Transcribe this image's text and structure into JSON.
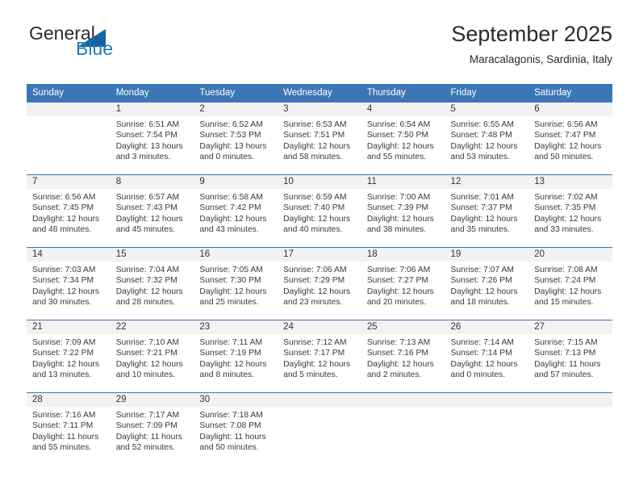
{
  "brand": {
    "name_part1": "General",
    "name_part2": "Blue",
    "logo_icon": "triangle-icon",
    "accent_color": "#1b7ac4"
  },
  "header": {
    "title": "September 2025",
    "subtitle": "Maracalagonis, Sardinia, Italy"
  },
  "theme": {
    "header_blue": "#3b77b7",
    "band_gray": "#f2f2f2",
    "text_color": "#3a3a3a"
  },
  "weekdays": [
    "Sunday",
    "Monday",
    "Tuesday",
    "Wednesday",
    "Thursday",
    "Friday",
    "Saturday"
  ],
  "weeks": [
    [
      {
        "day": "",
        "sunrise": "",
        "sunset": "",
        "daylight_line1": "",
        "daylight_line2": ""
      },
      {
        "day": "1",
        "sunrise": "Sunrise: 6:51 AM",
        "sunset": "Sunset: 7:54 PM",
        "daylight_line1": "Daylight: 13 hours",
        "daylight_line2": "and 3 minutes."
      },
      {
        "day": "2",
        "sunrise": "Sunrise: 6:52 AM",
        "sunset": "Sunset: 7:53 PM",
        "daylight_line1": "Daylight: 13 hours",
        "daylight_line2": "and 0 minutes."
      },
      {
        "day": "3",
        "sunrise": "Sunrise: 6:53 AM",
        "sunset": "Sunset: 7:51 PM",
        "daylight_line1": "Daylight: 12 hours",
        "daylight_line2": "and 58 minutes."
      },
      {
        "day": "4",
        "sunrise": "Sunrise: 6:54 AM",
        "sunset": "Sunset: 7:50 PM",
        "daylight_line1": "Daylight: 12 hours",
        "daylight_line2": "and 55 minutes."
      },
      {
        "day": "5",
        "sunrise": "Sunrise: 6:55 AM",
        "sunset": "Sunset: 7:48 PM",
        "daylight_line1": "Daylight: 12 hours",
        "daylight_line2": "and 53 minutes."
      },
      {
        "day": "6",
        "sunrise": "Sunrise: 6:56 AM",
        "sunset": "Sunset: 7:47 PM",
        "daylight_line1": "Daylight: 12 hours",
        "daylight_line2": "and 50 minutes."
      }
    ],
    [
      {
        "day": "7",
        "sunrise": "Sunrise: 6:56 AM",
        "sunset": "Sunset: 7:45 PM",
        "daylight_line1": "Daylight: 12 hours",
        "daylight_line2": "and 48 minutes."
      },
      {
        "day": "8",
        "sunrise": "Sunrise: 6:57 AM",
        "sunset": "Sunset: 7:43 PM",
        "daylight_line1": "Daylight: 12 hours",
        "daylight_line2": "and 45 minutes."
      },
      {
        "day": "9",
        "sunrise": "Sunrise: 6:58 AM",
        "sunset": "Sunset: 7:42 PM",
        "daylight_line1": "Daylight: 12 hours",
        "daylight_line2": "and 43 minutes."
      },
      {
        "day": "10",
        "sunrise": "Sunrise: 6:59 AM",
        "sunset": "Sunset: 7:40 PM",
        "daylight_line1": "Daylight: 12 hours",
        "daylight_line2": "and 40 minutes."
      },
      {
        "day": "11",
        "sunrise": "Sunrise: 7:00 AM",
        "sunset": "Sunset: 7:39 PM",
        "daylight_line1": "Daylight: 12 hours",
        "daylight_line2": "and 38 minutes."
      },
      {
        "day": "12",
        "sunrise": "Sunrise: 7:01 AM",
        "sunset": "Sunset: 7:37 PM",
        "daylight_line1": "Daylight: 12 hours",
        "daylight_line2": "and 35 minutes."
      },
      {
        "day": "13",
        "sunrise": "Sunrise: 7:02 AM",
        "sunset": "Sunset: 7:35 PM",
        "daylight_line1": "Daylight: 12 hours",
        "daylight_line2": "and 33 minutes."
      }
    ],
    [
      {
        "day": "14",
        "sunrise": "Sunrise: 7:03 AM",
        "sunset": "Sunset: 7:34 PM",
        "daylight_line1": "Daylight: 12 hours",
        "daylight_line2": "and 30 minutes."
      },
      {
        "day": "15",
        "sunrise": "Sunrise: 7:04 AM",
        "sunset": "Sunset: 7:32 PM",
        "daylight_line1": "Daylight: 12 hours",
        "daylight_line2": "and 28 minutes."
      },
      {
        "day": "16",
        "sunrise": "Sunrise: 7:05 AM",
        "sunset": "Sunset: 7:30 PM",
        "daylight_line1": "Daylight: 12 hours",
        "daylight_line2": "and 25 minutes."
      },
      {
        "day": "17",
        "sunrise": "Sunrise: 7:06 AM",
        "sunset": "Sunset: 7:29 PM",
        "daylight_line1": "Daylight: 12 hours",
        "daylight_line2": "and 23 minutes."
      },
      {
        "day": "18",
        "sunrise": "Sunrise: 7:06 AM",
        "sunset": "Sunset: 7:27 PM",
        "daylight_line1": "Daylight: 12 hours",
        "daylight_line2": "and 20 minutes."
      },
      {
        "day": "19",
        "sunrise": "Sunrise: 7:07 AM",
        "sunset": "Sunset: 7:26 PM",
        "daylight_line1": "Daylight: 12 hours",
        "daylight_line2": "and 18 minutes."
      },
      {
        "day": "20",
        "sunrise": "Sunrise: 7:08 AM",
        "sunset": "Sunset: 7:24 PM",
        "daylight_line1": "Daylight: 12 hours",
        "daylight_line2": "and 15 minutes."
      }
    ],
    [
      {
        "day": "21",
        "sunrise": "Sunrise: 7:09 AM",
        "sunset": "Sunset: 7:22 PM",
        "daylight_line1": "Daylight: 12 hours",
        "daylight_line2": "and 13 minutes."
      },
      {
        "day": "22",
        "sunrise": "Sunrise: 7:10 AM",
        "sunset": "Sunset: 7:21 PM",
        "daylight_line1": "Daylight: 12 hours",
        "daylight_line2": "and 10 minutes."
      },
      {
        "day": "23",
        "sunrise": "Sunrise: 7:11 AM",
        "sunset": "Sunset: 7:19 PM",
        "daylight_line1": "Daylight: 12 hours",
        "daylight_line2": "and 8 minutes."
      },
      {
        "day": "24",
        "sunrise": "Sunrise: 7:12 AM",
        "sunset": "Sunset: 7:17 PM",
        "daylight_line1": "Daylight: 12 hours",
        "daylight_line2": "and 5 minutes."
      },
      {
        "day": "25",
        "sunrise": "Sunrise: 7:13 AM",
        "sunset": "Sunset: 7:16 PM",
        "daylight_line1": "Daylight: 12 hours",
        "daylight_line2": "and 2 minutes."
      },
      {
        "day": "26",
        "sunrise": "Sunrise: 7:14 AM",
        "sunset": "Sunset: 7:14 PM",
        "daylight_line1": "Daylight: 12 hours",
        "daylight_line2": "and 0 minutes."
      },
      {
        "day": "27",
        "sunrise": "Sunrise: 7:15 AM",
        "sunset": "Sunset: 7:13 PM",
        "daylight_line1": "Daylight: 11 hours",
        "daylight_line2": "and 57 minutes."
      }
    ],
    [
      {
        "day": "28",
        "sunrise": "Sunrise: 7:16 AM",
        "sunset": "Sunset: 7:11 PM",
        "daylight_line1": "Daylight: 11 hours",
        "daylight_line2": "and 55 minutes."
      },
      {
        "day": "29",
        "sunrise": "Sunrise: 7:17 AM",
        "sunset": "Sunset: 7:09 PM",
        "daylight_line1": "Daylight: 11 hours",
        "daylight_line2": "and 52 minutes."
      },
      {
        "day": "30",
        "sunrise": "Sunrise: 7:18 AM",
        "sunset": "Sunset: 7:08 PM",
        "daylight_line1": "Daylight: 11 hours",
        "daylight_line2": "and 50 minutes."
      },
      {
        "day": "",
        "sunrise": "",
        "sunset": "",
        "daylight_line1": "",
        "daylight_line2": ""
      },
      {
        "day": "",
        "sunrise": "",
        "sunset": "",
        "daylight_line1": "",
        "daylight_line2": ""
      },
      {
        "day": "",
        "sunrise": "",
        "sunset": "",
        "daylight_line1": "",
        "daylight_line2": ""
      },
      {
        "day": "",
        "sunrise": "",
        "sunset": "",
        "daylight_line1": "",
        "daylight_line2": ""
      }
    ]
  ]
}
